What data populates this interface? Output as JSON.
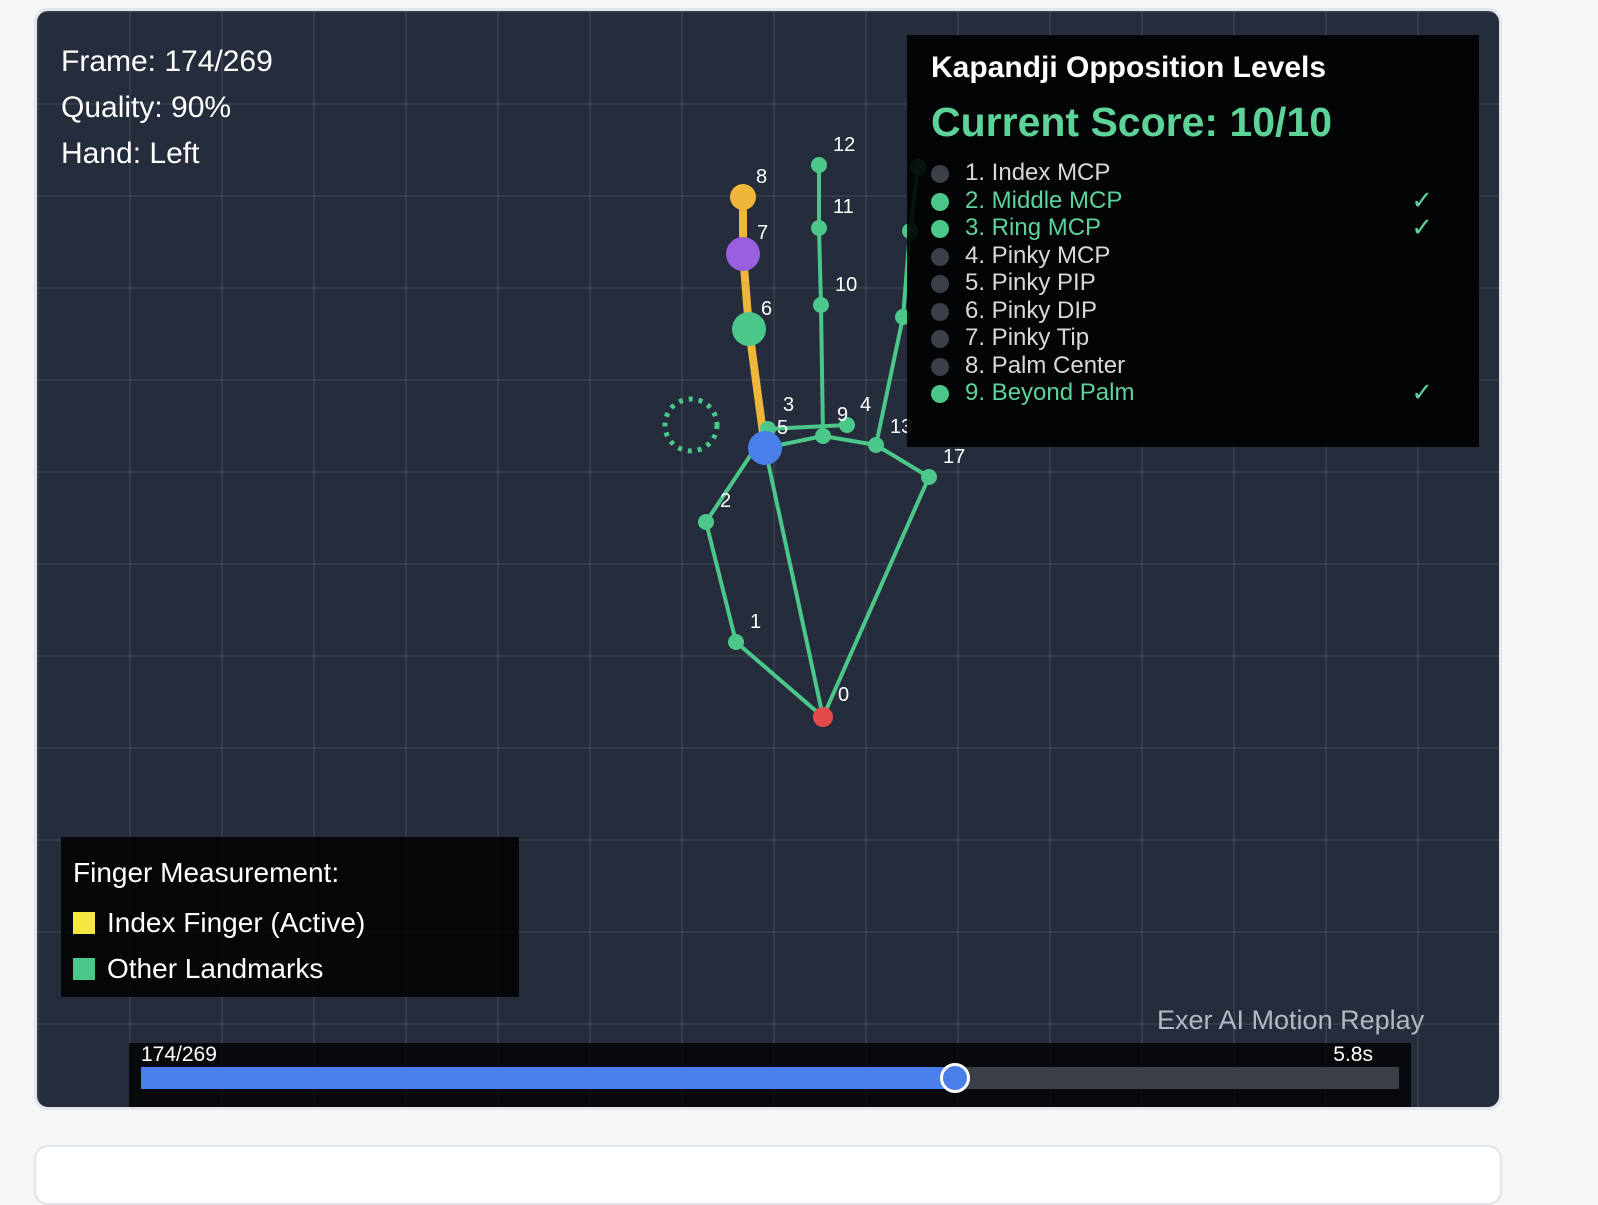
{
  "hud": {
    "frame_text": "Frame: 174/269",
    "quality_text": "Quality: 90%",
    "hand_text": "Hand: Left"
  },
  "hand_landmarks": [
    {
      "id": "0",
      "label": "0"
    },
    {
      "id": "1",
      "label": "1"
    },
    {
      "id": "2",
      "label": "2"
    },
    {
      "id": "3",
      "label": "3"
    },
    {
      "id": "4",
      "label": "4"
    },
    {
      "id": "5",
      "label": "5"
    },
    {
      "id": "6",
      "label": "6"
    },
    {
      "id": "7",
      "label": "7"
    },
    {
      "id": "8",
      "label": "8"
    },
    {
      "id": "9",
      "label": "9"
    },
    {
      "id": "10",
      "label": "10"
    },
    {
      "id": "11",
      "label": "11"
    },
    {
      "id": "12",
      "label": "12"
    },
    {
      "id": "13",
      "label": "13"
    },
    {
      "id": "17",
      "label": "17"
    }
  ],
  "colors": {
    "skeleton": "#4cc78a",
    "active_finger": "#f0b63a",
    "wrist": "#e24b4b",
    "index_mcp": "#4a7ee9",
    "index_dip": "#9a5fe0",
    "accent": "#5dd39a",
    "timeline": "#4a7ee9"
  },
  "kapandji": {
    "title": "Kapandji Opposition Levels",
    "score_text": "Current Score: 10/10",
    "levels": [
      {
        "label": "1. Index MCP",
        "achieved": false
      },
      {
        "label": "2. Middle MCP",
        "achieved": true
      },
      {
        "label": "3. Ring MCP",
        "achieved": true
      },
      {
        "label": "4. Pinky MCP",
        "achieved": false
      },
      {
        "label": "5. Pinky PIP",
        "achieved": false
      },
      {
        "label": "6. Pinky DIP",
        "achieved": false
      },
      {
        "label": "7. Pinky Tip",
        "achieved": false
      },
      {
        "label": "8. Palm Center",
        "achieved": false
      },
      {
        "label": "9. Beyond Palm",
        "achieved": true
      }
    ],
    "check_glyph": "✓"
  },
  "legend": {
    "title": "Finger Measurement:",
    "items": [
      {
        "label": "Index Finger (Active)",
        "color": "#f5e642"
      },
      {
        "label": "Other Landmarks",
        "color": "#4cc78a"
      }
    ]
  },
  "watermark": "Exer AI Motion Replay",
  "timeline": {
    "frame_text": "174/269",
    "time_text": "5.8s",
    "current_frame": 174,
    "total_frames": 269
  }
}
